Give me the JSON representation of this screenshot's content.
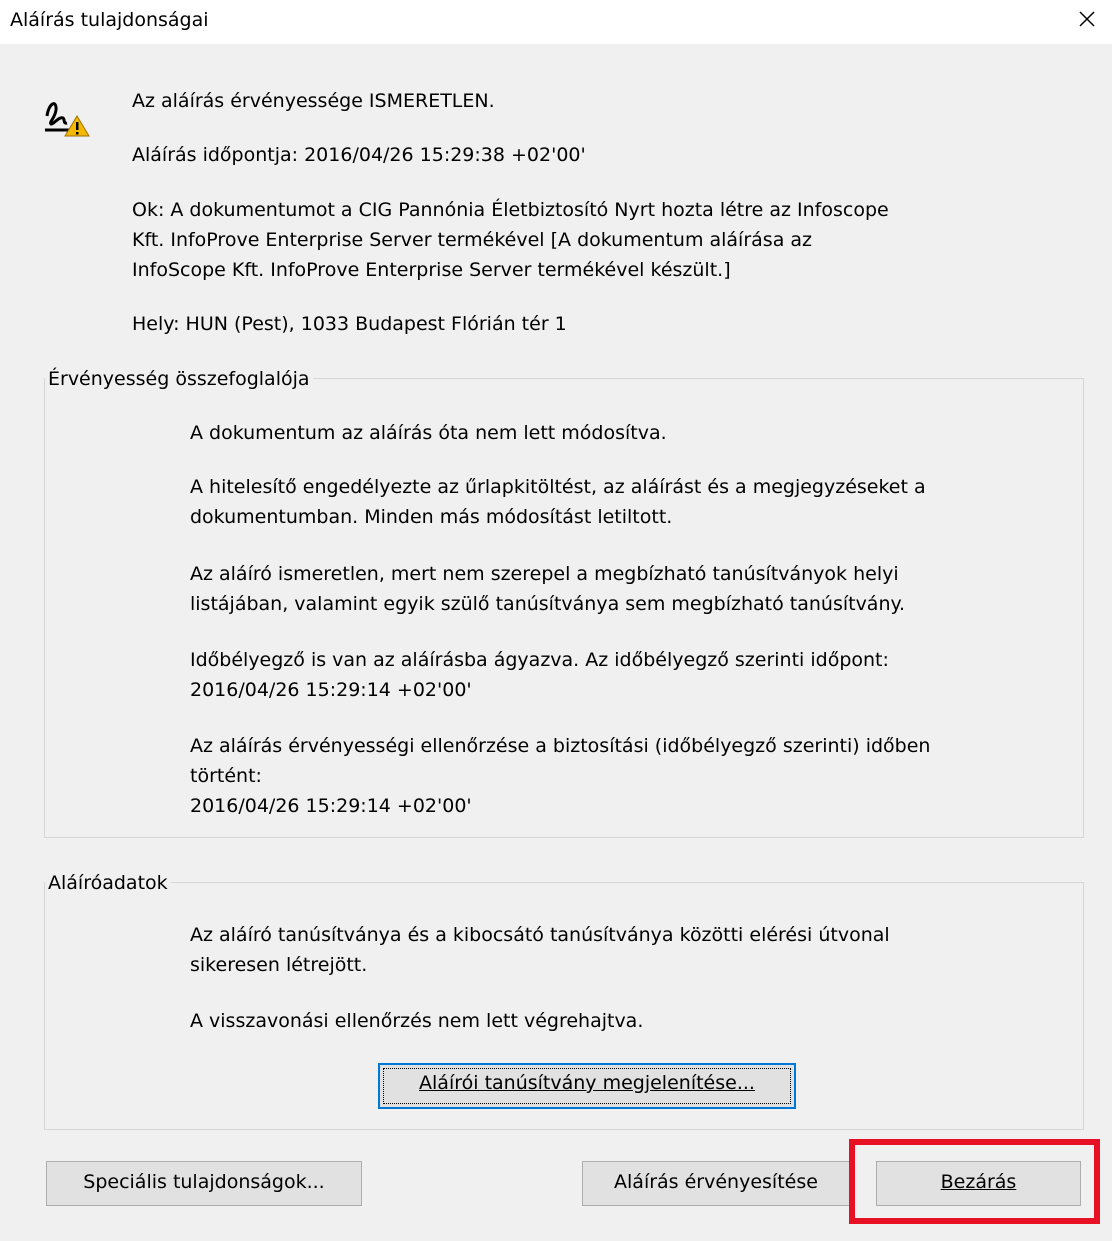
{
  "window": {
    "title": "Aláírás tulajdonságai",
    "close_icon": "close-icon"
  },
  "signature": {
    "status_icon": "signature-warning-icon",
    "status": "Az aláírás érvényessége ISMERETLEN.",
    "time": "Aláírás időpontja:  2016/04/26 15:29:38 +02'00'",
    "reason": "Ok:  A dokumentumot a CIG Pannónia Életbiztosító Nyrt hozta létre az Infoscope\nKft. InfoProve Enterprise Server termékével [A dokumentum aláírása az\nInfoScope Kft. InfoProve Enterprise Server termékével készült.]",
    "location": "Hely:  HUN (Pest), 1033 Budapest Flórián tér 1"
  },
  "validity_summary": {
    "legend": "Érvényesség összefoglalója",
    "items": [
      "A dokumentum az aláírás óta nem lett módosítva.",
      "A hitelesítő engedélyezte az űrlapkitöltést, az aláírást és a megjegyzéseket a\ndokumentumban. Minden más módosítást letiltott.",
      "Az aláíró ismeretlen, mert nem szerepel a megbízható tanúsítványok helyi\nlistájában, valamint egyik szülő tanúsítványa sem megbízható tanúsítvány.",
      "Időbélyegző is van az aláírásba ágyazva. Az időbélyegző szerinti időpont:\n2016/04/26 15:29:14 +02'00'",
      "Az aláírás érvényességi ellenőrzése a biztosítási (időbélyegző szerinti) időben\ntörtént:\n2016/04/26 15:29:14 +02'00'"
    ]
  },
  "signer_data": {
    "legend": "Aláíróadatok",
    "items": [
      "Az aláíró tanúsítványa és a kibocsátó tanúsítványa közötti elérési útvonal\nsikeresen létrejött.",
      "A visszavonási ellenőrzés nem lett végrehajtva."
    ],
    "show_cert_button": "Aláírói tanúsítvány megjelenítése..."
  },
  "footer": {
    "advanced_button": "Speciális tulajdonságok...",
    "validate_button": "Aláírás érvényesítése",
    "close_button": "Bezárás"
  },
  "accent_colors": {
    "focus": "#0078d7",
    "highlight": "#e81123",
    "warning": "#f0b400"
  }
}
